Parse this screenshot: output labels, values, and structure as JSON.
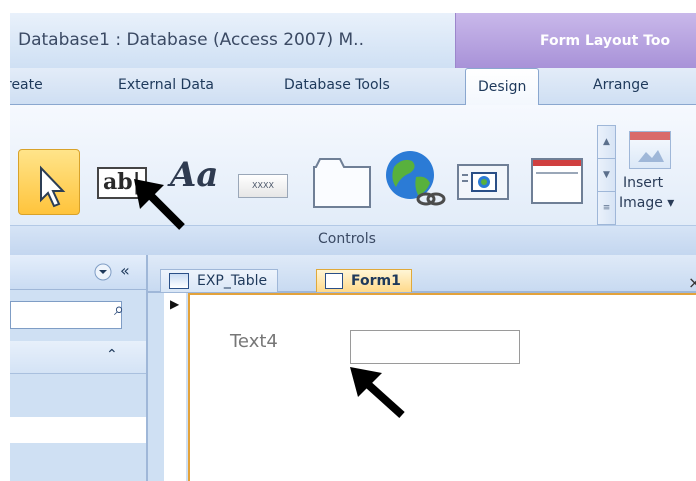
{
  "window": {
    "title": "Database1 : Database (Access 2007) M..",
    "context_tab": "Form Layout Too"
  },
  "ribbon_tabs": {
    "create": "reate",
    "external_data": "External Data",
    "database_tools": "Database Tools",
    "design": "Design",
    "arrange": "Arrange",
    "active": "Design"
  },
  "controls_group": {
    "label": "Controls",
    "label_control": "Aa",
    "textbox_control": "ab|",
    "button_control": "XXXX",
    "insert_image_line1": "Insert",
    "insert_image_line2": "Image ▾"
  },
  "nav_pane": {
    "search_value": "",
    "chevron_label": "«"
  },
  "document_tabs": {
    "table_tab": "EXP_Table",
    "form_tab": "Form1",
    "close": "×"
  },
  "form": {
    "text_label": "Text4",
    "text_value": ""
  },
  "colors": {
    "accent_purple": "#a892d8",
    "selected_orange": "#ffc43c",
    "ribbon_blue": "#cfdff3"
  }
}
